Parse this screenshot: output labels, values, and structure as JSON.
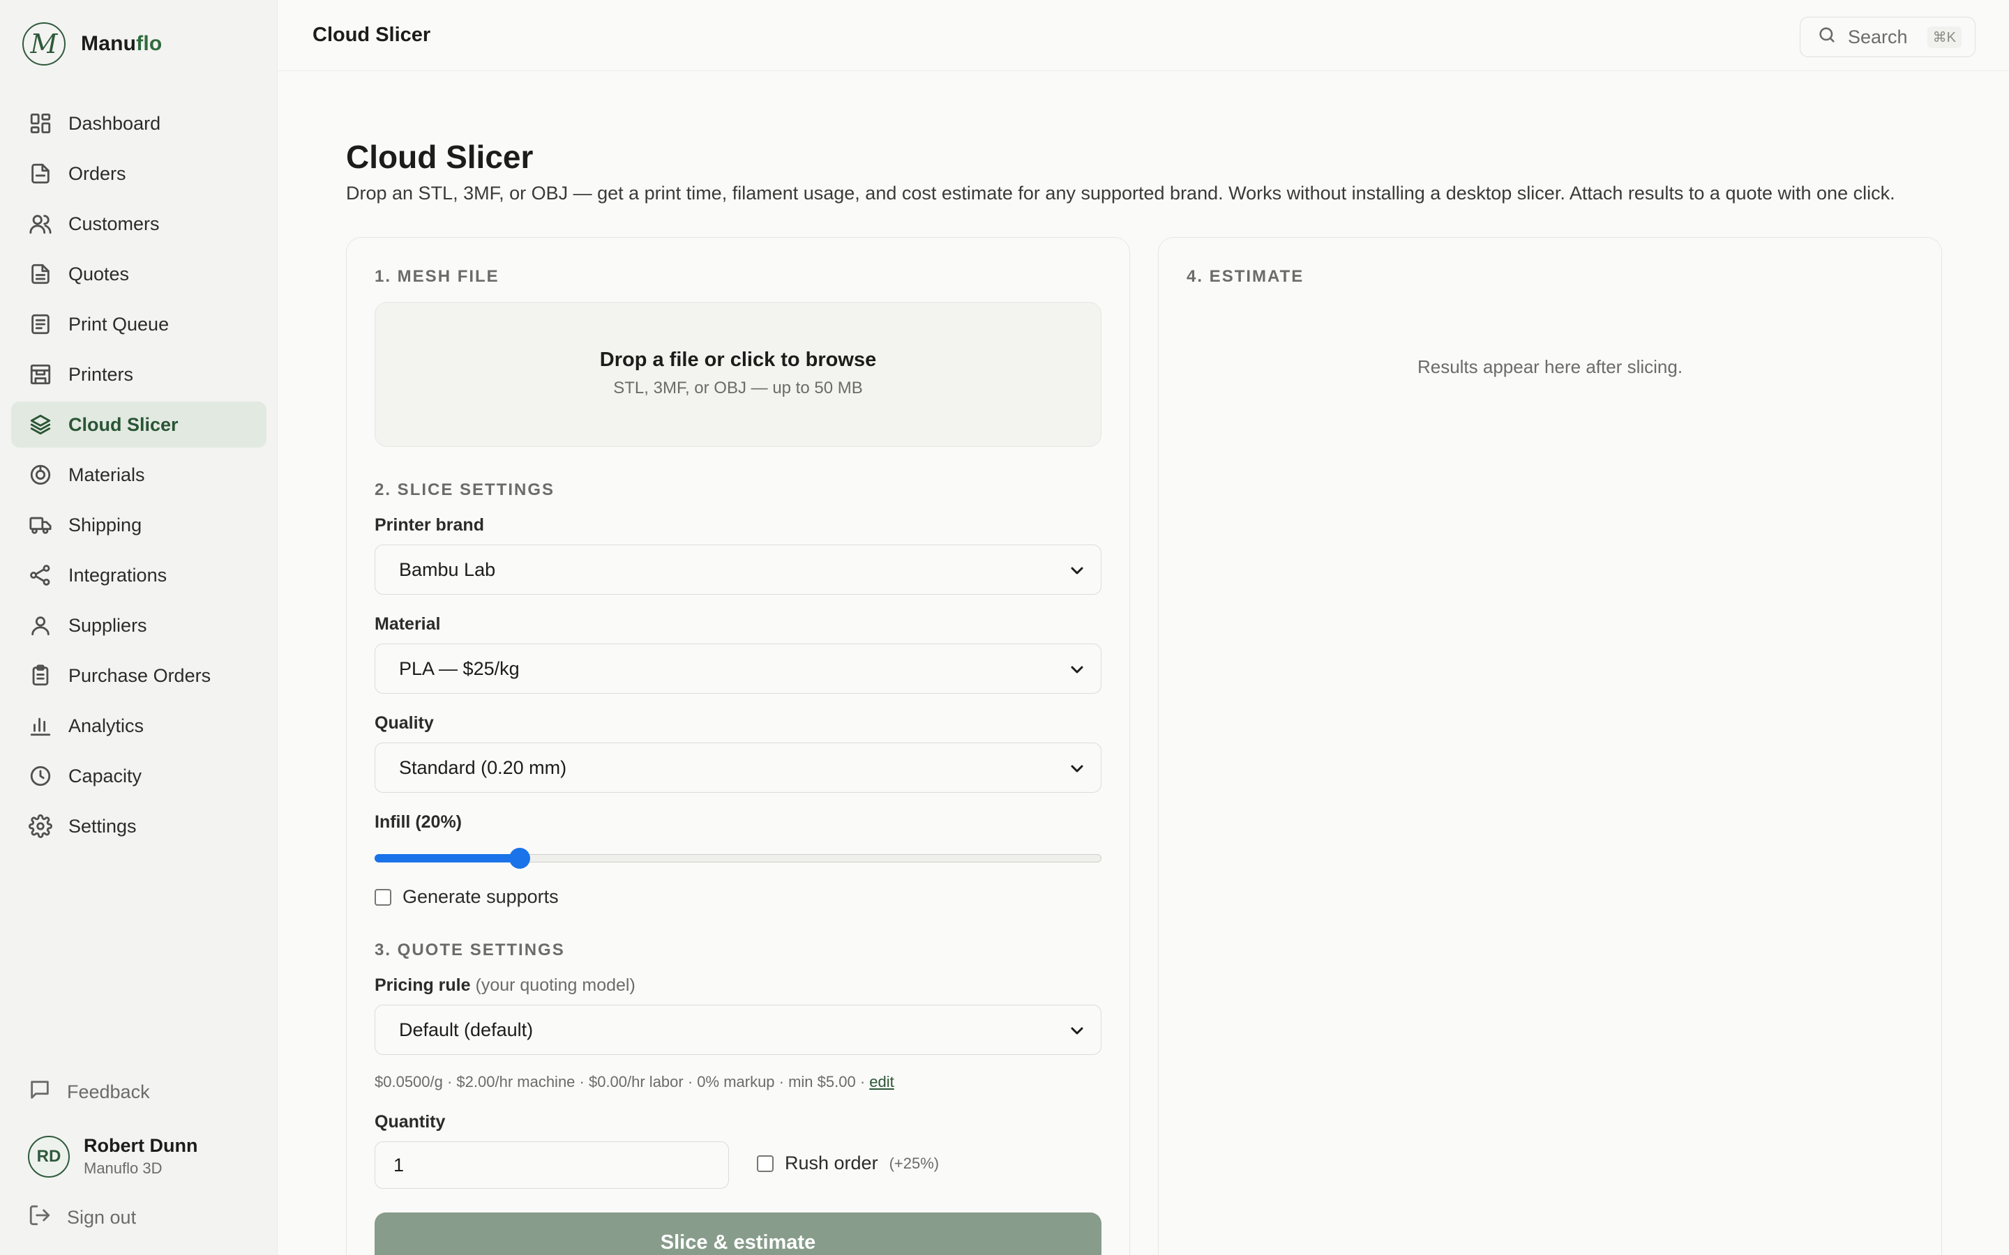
{
  "brand": {
    "name_main": "Manu",
    "name_accent": "flo",
    "logo_letter": "M"
  },
  "sidebar": {
    "items": [
      {
        "label": "Dashboard",
        "icon": "dashboard-icon"
      },
      {
        "label": "Orders",
        "icon": "orders-icon"
      },
      {
        "label": "Customers",
        "icon": "customers-icon"
      },
      {
        "label": "Quotes",
        "icon": "quotes-icon"
      },
      {
        "label": "Print Queue",
        "icon": "print-queue-icon"
      },
      {
        "label": "Printers",
        "icon": "printer-icon"
      },
      {
        "label": "Cloud Slicer",
        "icon": "layers-icon",
        "active": true
      },
      {
        "label": "Materials",
        "icon": "materials-icon"
      },
      {
        "label": "Shipping",
        "icon": "truck-icon"
      },
      {
        "label": "Integrations",
        "icon": "share-icon"
      },
      {
        "label": "Suppliers",
        "icon": "user-icon"
      },
      {
        "label": "Purchase Orders",
        "icon": "clipboard-icon"
      },
      {
        "label": "Analytics",
        "icon": "bar-chart-icon"
      },
      {
        "label": "Capacity",
        "icon": "clock-icon"
      },
      {
        "label": "Settings",
        "icon": "gear-icon"
      }
    ],
    "feedback_label": "Feedback",
    "user": {
      "initials": "RD",
      "name": "Robert Dunn",
      "org": "Manuflo 3D"
    },
    "signout_label": "Sign out"
  },
  "topbar": {
    "title": "Cloud Slicer",
    "search_label": "Search",
    "search_shortcut": "⌘K"
  },
  "main": {
    "title": "Cloud Slicer",
    "description": "Drop an STL, 3MF, or OBJ — get a print time, filament usage, and cost estimate for any supported brand. Works without installing a desktop slicer. Attach results to a quote with one click.",
    "mesh": {
      "section": "1. MESH FILE",
      "drop_title": "Drop a file or click to browse",
      "drop_sub": "STL, 3MF, or OBJ — up to 50 MB"
    },
    "slice": {
      "section": "2. SLICE SETTINGS",
      "printer_label": "Printer brand",
      "printer_value": "Bambu Lab",
      "material_label": "Material",
      "material_value": "PLA — $25/kg",
      "quality_label": "Quality",
      "quality_value": "Standard (0.20 mm)",
      "infill_label": "Infill (20%)",
      "infill_fraction": 0.2,
      "supports_label": "Generate supports",
      "supports_checked": false
    },
    "quote": {
      "section": "3. QUOTE SETTINGS",
      "pricing_label": "Pricing rule",
      "pricing_hint": "(your quoting model)",
      "pricing_value": "Default (default)",
      "pricing_details": "$0.0500/g · $2.00/hr machine · $0.00/hr labor · 0% markup · min $5.00 · ",
      "edit_label": "edit",
      "quantity_label": "Quantity",
      "quantity_value": "1",
      "rush_label": "Rush order",
      "rush_hint": "(+25%)",
      "rush_checked": false,
      "submit_label": "Slice & estimate"
    },
    "estimate": {
      "section": "4. ESTIMATE",
      "empty_text": "Results appear here after slicing."
    }
  },
  "colors": {
    "accent": "#2a5535",
    "active_bg": "#e2e9e1",
    "button": "#879c8a",
    "slider": "#1a73e8"
  }
}
